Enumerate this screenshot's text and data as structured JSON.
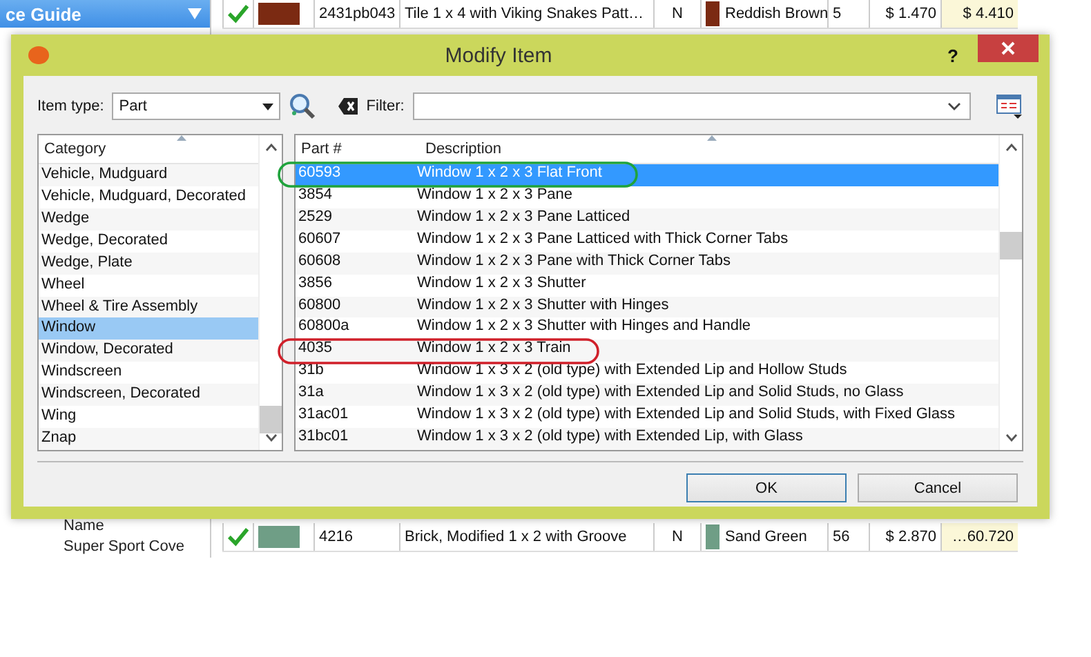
{
  "background": {
    "sidebar": {
      "header": "ce Guide",
      "items": [
        "Name",
        "Super Sport Cove"
      ]
    },
    "rows": [
      {
        "part": "2431pb043",
        "description": "Tile 1 x 4 with Viking Snakes Patt…",
        "condition": "N",
        "color_name": "Reddish Brown",
        "color": "#7b2a12",
        "qty": "5",
        "price": "$ 1.470",
        "total": "$ 4.410"
      },
      {
        "part": "4216",
        "description": "Brick, Modified 1 x 2 with Groove",
        "condition": "N",
        "color_name": "Sand Green",
        "color": "#6f9e86",
        "qty": "56",
        "price": "$ 2.870",
        "total": "…60.720"
      }
    ]
  },
  "dialog": {
    "title": "Modify Item",
    "help": "?",
    "item_type_label": "Item type:",
    "item_type": "Part",
    "filter_label": "Filter:",
    "categories": {
      "header": "Category",
      "items": [
        {
          "label": "Vehicle, Mudguard",
          "selected": false
        },
        {
          "label": "Vehicle, Mudguard, Decorated",
          "selected": false
        },
        {
          "label": "Wedge",
          "selected": false
        },
        {
          "label": "Wedge, Decorated",
          "selected": false
        },
        {
          "label": "Wedge, Plate",
          "selected": false
        },
        {
          "label": "Wheel",
          "selected": false
        },
        {
          "label": "Wheel & Tire Assembly",
          "selected": false
        },
        {
          "label": "Window",
          "selected": true
        },
        {
          "label": "Window, Decorated",
          "selected": false
        },
        {
          "label": "Windscreen",
          "selected": false
        },
        {
          "label": "Windscreen, Decorated",
          "selected": false
        },
        {
          "label": "Wing",
          "selected": false
        },
        {
          "label": "Znap",
          "selected": false
        }
      ]
    },
    "parts": {
      "columns": [
        "Part #",
        "Description"
      ],
      "rows": [
        {
          "part": "60593",
          "description": "Window 1 x 2 x 3 Flat Front",
          "selected": true,
          "color": "#1fa33c"
        },
        {
          "part": "3854",
          "description": "Window 1 x 2 x 3 Pane",
          "selected": false
        },
        {
          "part": "2529",
          "description": "Window 1 x 2 x 3 Pane Latticed",
          "selected": false
        },
        {
          "part": "60607",
          "description": "Window 1 x 2 x 3 Pane Latticed with Thick Corner Tabs",
          "selected": false
        },
        {
          "part": "60608",
          "description": "Window 1 x 2 x 3 Pane with Thick Corner Tabs",
          "selected": false
        },
        {
          "part": "3856",
          "description": "Window 1 x 2 x 3 Shutter",
          "selected": false
        },
        {
          "part": "60800",
          "description": "Window 1 x 2 x 3 Shutter with Hinges",
          "selected": false
        },
        {
          "part": "60800a",
          "description": "Window 1 x 2 x 3 Shutter with Hinges and Handle",
          "selected": false
        },
        {
          "part": "4035",
          "description": "Window 1 x 2 x 3 Train",
          "selected": false,
          "color": "#d0202a"
        },
        {
          "part": "31b",
          "description": "Window 1 x 3 x 2 (old type) with Extended Lip and Hollow Studs",
          "selected": false
        },
        {
          "part": "31a",
          "description": "Window 1 x 3 x 2 (old type) with Extended Lip and Solid Studs, no Glass",
          "selected": false
        },
        {
          "part": "31ac01",
          "description": "Window 1 x 3 x 2 (old type) with Extended Lip and Solid Studs, with Fixed Glass",
          "selected": false
        },
        {
          "part": "31bc01",
          "description": "Window 1 x 3 x 2 (old type) with Extended Lip, with Glass",
          "selected": false
        }
      ]
    },
    "buttons": [
      "OK",
      "Cancel"
    ]
  }
}
